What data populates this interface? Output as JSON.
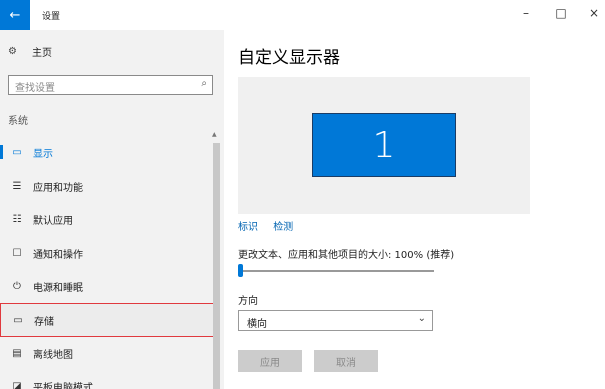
{
  "window": {
    "back_icon": "back-arrow-icon",
    "back_glyph": "←",
    "title": "设置",
    "minimize": "–",
    "maximize": "□",
    "close": "×"
  },
  "sidebar": {
    "home": {
      "icon": "gear-icon",
      "glyph": "⚙",
      "label": "主页"
    },
    "search": {
      "placeholder": "查找设置",
      "icon": "search-icon",
      "glyph": "⌕"
    },
    "group_label": "系统",
    "items": [
      {
        "icon": "display-icon",
        "glyph": "▭",
        "label": "显示",
        "active": true
      },
      {
        "icon": "apps-features-icon",
        "glyph": "☰",
        "label": "应用和功能",
        "active": false
      },
      {
        "icon": "default-apps-icon",
        "glyph": "☷",
        "label": "默认应用",
        "active": false
      },
      {
        "icon": "notifications-icon",
        "glyph": "☐",
        "label": "通知和操作",
        "active": false
      },
      {
        "icon": "power-sleep-icon",
        "glyph": "⏻",
        "label": "电源和睡眠",
        "active": false
      },
      {
        "icon": "storage-icon",
        "glyph": "▭",
        "label": "存储",
        "active": false
      },
      {
        "icon": "offline-maps-icon",
        "glyph": "▤",
        "label": "离线地图",
        "active": false
      },
      {
        "icon": "tablet-mode-icon",
        "glyph": "◪",
        "label": "平板电脑模式",
        "active": false
      }
    ]
  },
  "main": {
    "title": "自定义显示器",
    "monitor_number": "1",
    "link_identify": "标识",
    "link_detect": "检测",
    "scale_label": "更改文本、应用和其他项目的大小: 100% (推荐)",
    "scale_value_fraction": 0,
    "orientation_label": "方向",
    "orientation_value": "横向",
    "apply_label": "应用",
    "cancel_label": "取消"
  },
  "colors": {
    "accent": "#0078d7",
    "highlight_border": "#e0393e",
    "link": "#0063b1"
  }
}
